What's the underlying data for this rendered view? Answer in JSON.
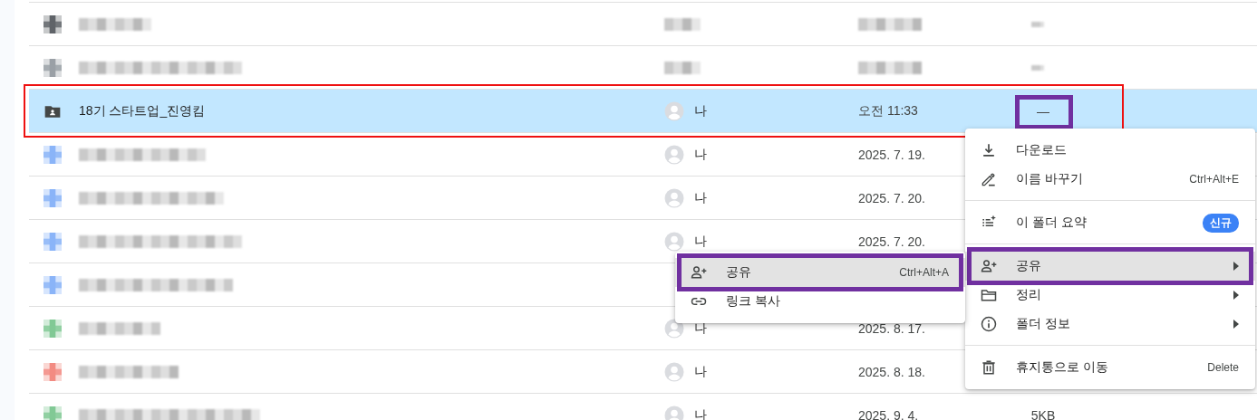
{
  "rows": [
    {
      "kind": "pixelated",
      "color": "#5f6368",
      "selected": false
    },
    {
      "kind": "pixelated",
      "color": "#9aa0a6",
      "selected": false
    },
    {
      "kind": "folder",
      "name": "18기 스타트업_진영킴",
      "owner": "나",
      "modified": "오전 11:33",
      "size": "—",
      "selected": true,
      "annotated": true,
      "size_annotated": true
    },
    {
      "kind": "pixelated-name",
      "color": "#8ab4f8",
      "owner": "나",
      "modified": "2025. 7. 19.",
      "selected": false
    },
    {
      "kind": "pixelated-name",
      "color": "#8ab4f8",
      "owner": "나",
      "modified": "2025. 7. 20.",
      "selected": false
    },
    {
      "kind": "pixelated-name",
      "color": "#8ab4f8",
      "owner": "나",
      "modified": "2025. 7. 20.",
      "selected": false
    },
    {
      "kind": "pixelated-name",
      "color": "#8ab4f8",
      "selected": false
    },
    {
      "kind": "pixelated-name",
      "color": "#81c995",
      "owner": "나",
      "modified": "2025. 8. 17.",
      "selected": false
    },
    {
      "kind": "pixelated-name",
      "color": "#f28b82",
      "owner": "나",
      "modified": "2025. 8. 18.",
      "selected": false
    },
    {
      "kind": "pixelated-name",
      "color": "#81c995",
      "owner": "나",
      "modified": "2025. 9. 4.",
      "size": "5KB",
      "selected": false
    }
  ],
  "context_menu": {
    "items": [
      {
        "kind": "item",
        "label": "다운로드",
        "selected": false
      },
      {
        "kind": "item",
        "label": "이름 바꾸기",
        "shortcut": "Ctrl+Alt+E",
        "selected": false
      },
      {
        "kind": "divider"
      },
      {
        "kind": "item",
        "label": "이 폴더 요약",
        "badge": "신규",
        "selected": false
      },
      {
        "kind": "divider"
      },
      {
        "kind": "item",
        "label": "공유",
        "submenu": true,
        "selected": true,
        "annotated": true
      },
      {
        "kind": "item",
        "label": "정리",
        "submenu": true,
        "selected": false
      },
      {
        "kind": "item",
        "label": "폴더 정보",
        "submenu": true,
        "selected": false
      },
      {
        "kind": "divider"
      },
      {
        "kind": "item",
        "label": "휴지통으로 이동",
        "shortcut": "Delete",
        "selected": false
      }
    ]
  },
  "share_submenu": {
    "items": [
      {
        "kind": "item",
        "label": "공유",
        "shortcut": "Ctrl+Alt+A",
        "selected": true,
        "annotated": true
      },
      {
        "kind": "item",
        "label": "링크 복사",
        "selected": false
      }
    ]
  }
}
